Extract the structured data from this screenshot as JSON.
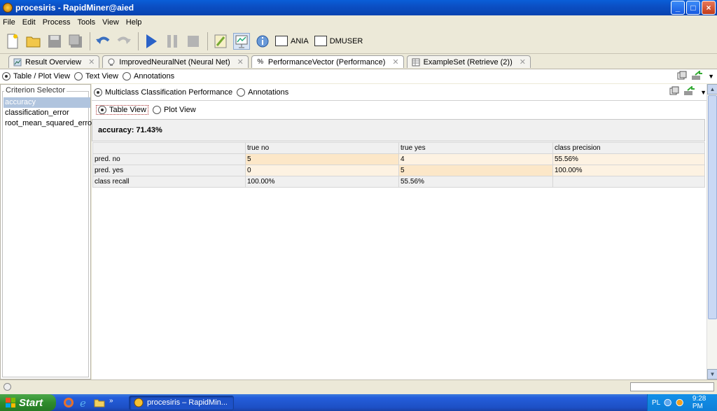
{
  "window": {
    "title": "procesiris - RapidMiner@aied",
    "buttons": [
      "_",
      "□",
      "×"
    ]
  },
  "menu": {
    "items": [
      "File",
      "Edit",
      "Process",
      "Tools",
      "View",
      "Help"
    ]
  },
  "toolbar": {
    "icons": [
      "new-icon",
      "open-icon",
      "save-icon",
      "save-as-icon",
      "undo-icon",
      "redo-icon",
      "run-icon",
      "pause-icon",
      "stop-icon",
      "design-perspective-icon",
      "result-perspective-icon",
      "welcome-perspective-icon"
    ],
    "perspectives": [
      "ANIA",
      "DMUSER"
    ]
  },
  "tabs": [
    {
      "label": "Result Overview",
      "icon": "result-overview-icon"
    },
    {
      "label": "ImprovedNeuralNet (Neural Net)",
      "icon": "bulb-icon"
    },
    {
      "label": "PerformanceVector (Performance)",
      "icon": "percent-icon"
    },
    {
      "label": "ExampleSet (Retrieve (2))",
      "icon": "table-icon"
    }
  ],
  "view_modes": {
    "options": [
      "Table / Plot View",
      "Text View",
      "Annotations"
    ],
    "selected": "Table / Plot View"
  },
  "criterion": {
    "legend": "Criterion Selector",
    "items": [
      "accuracy",
      "classification_error",
      "root_mean_squared_error"
    ],
    "selected": "accuracy"
  },
  "result": {
    "modes": [
      "Multiclass Classification Performance",
      "Annotations"
    ],
    "selected_mode": "Multiclass Classification Performance",
    "views": [
      "Table View",
      "Plot View"
    ],
    "selected_view": "Table View",
    "accuracy_text": "accuracy: 71.43%"
  },
  "table": {
    "headers": [
      "",
      "true no",
      "true yes",
      "class precision"
    ],
    "rows": [
      [
        "pred. no",
        "5",
        "4",
        "55.56%"
      ],
      [
        "pred. yes",
        "0",
        "5",
        "100.00%"
      ],
      [
        "class recall",
        "100.00%",
        "55.56%",
        ""
      ]
    ]
  },
  "taskbar": {
    "start_label": "Start",
    "task_label": "procesiris – RapidMin...",
    "language": "PL",
    "clock": "9:28 PM"
  },
  "colors": {
    "title_bar": "#0b4fc4",
    "selection": "#b0c4de",
    "cell_orange": "#fce7c8",
    "cell_light": "#fdf2e2",
    "taskbar": "#245edb",
    "start_button": "#2f8c2c"
  }
}
